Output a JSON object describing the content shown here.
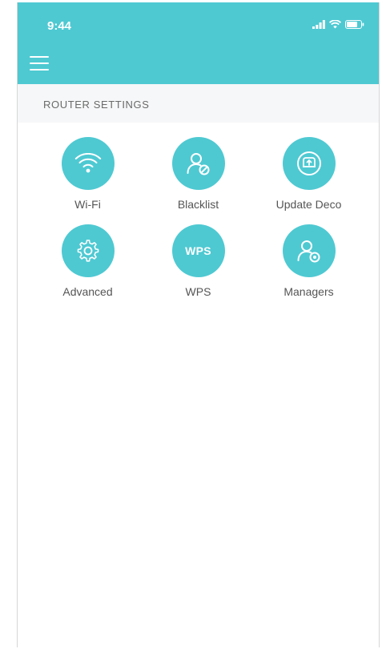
{
  "status_bar": {
    "time": "9:44",
    "icons": [
      "signal-icon",
      "wifi-icon",
      "battery-icon"
    ]
  },
  "header": {
    "menu_icon": "hamburger-menu-icon"
  },
  "section": {
    "title": "ROUTER SETTINGS"
  },
  "tiles": [
    {
      "label": "Wi-Fi",
      "icon": "wifi-icon"
    },
    {
      "label": "Blacklist",
      "icon": "user-blocked-icon"
    },
    {
      "label": "Update Deco",
      "icon": "deco-update-icon"
    },
    {
      "label": "Advanced",
      "icon": "gear-icon"
    },
    {
      "label": "WPS",
      "icon": "wps-icon",
      "icon_text": "WPS"
    },
    {
      "label": "Managers",
      "icon": "user-manager-icon"
    }
  ],
  "colors": {
    "accent": "#4ec9d2",
    "section_bg": "#f6f7f8",
    "label_text": "#555555"
  }
}
